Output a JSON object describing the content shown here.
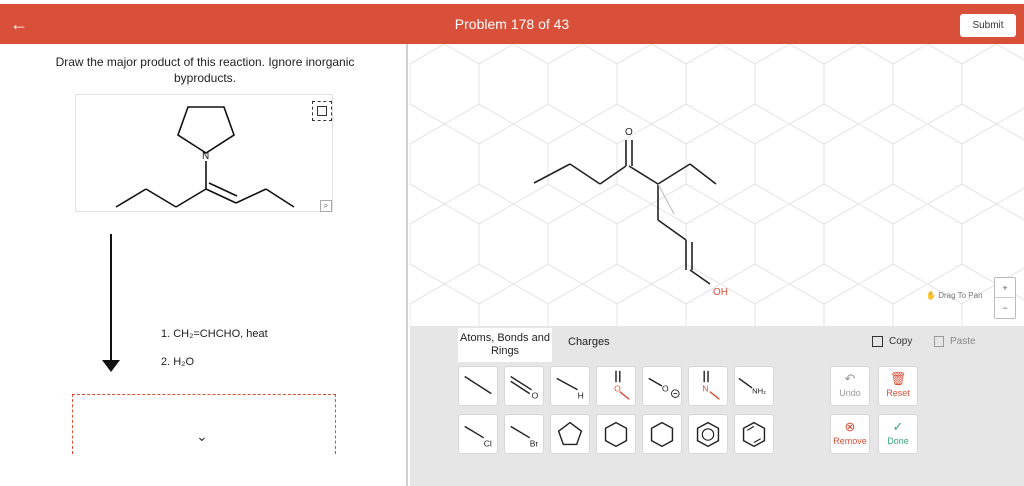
{
  "header": {
    "back_icon": "arrow-left-icon",
    "title": "Problem 178 of 43",
    "submit_label": "Submit",
    "bar_color": "#d9503a"
  },
  "question": {
    "prompt": "Draw the major product of this reaction. Ignore inorganic byproducts.",
    "reactant_atom_label": "N",
    "conditions": [
      "1. CH₂=CHCHO, heat",
      "2. H₂O"
    ]
  },
  "canvas": {
    "atom_labels": {
      "carbonyl_o": "O",
      "hydroxyl": "OH"
    },
    "drag_to_pan": "Drag To Pan",
    "zoom_in": "+",
    "zoom_out": "−"
  },
  "toolbar": {
    "tabs": [
      "Atoms, Bonds and Rings",
      "Charges"
    ],
    "copy_label": "Copy",
    "paste_label": "Paste",
    "tools_row1": [
      {
        "name": "single-bond-tool",
        "label": ""
      },
      {
        "name": "double-bond-o-tool",
        "label": "O"
      },
      {
        "name": "hydrogen-tool",
        "label": "H"
      },
      {
        "name": "carbonyl-tool",
        "label": "O"
      },
      {
        "name": "oxide-anion-tool",
        "label": "O"
      },
      {
        "name": "nitrogen-tool",
        "label": "N"
      },
      {
        "name": "amine-tool",
        "label": "NH₂"
      }
    ],
    "tools_row2": [
      {
        "name": "chlorine-tool",
        "label": "Cl"
      },
      {
        "name": "bromine-tool",
        "label": "Br"
      },
      {
        "name": "cyclopentane-tool",
        "label": ""
      },
      {
        "name": "cyclohexane-tool",
        "label": ""
      },
      {
        "name": "cyclohexene-tool",
        "label": ""
      },
      {
        "name": "benzene-tool",
        "label": ""
      },
      {
        "name": "cyclohexadiene-tool",
        "label": ""
      }
    ],
    "undo_label": "Undo",
    "reset_label": "Reset",
    "remove_label": "Remove",
    "done_label": "Done",
    "accent_color": "#d9503a",
    "done_color": "#3aa57a"
  }
}
